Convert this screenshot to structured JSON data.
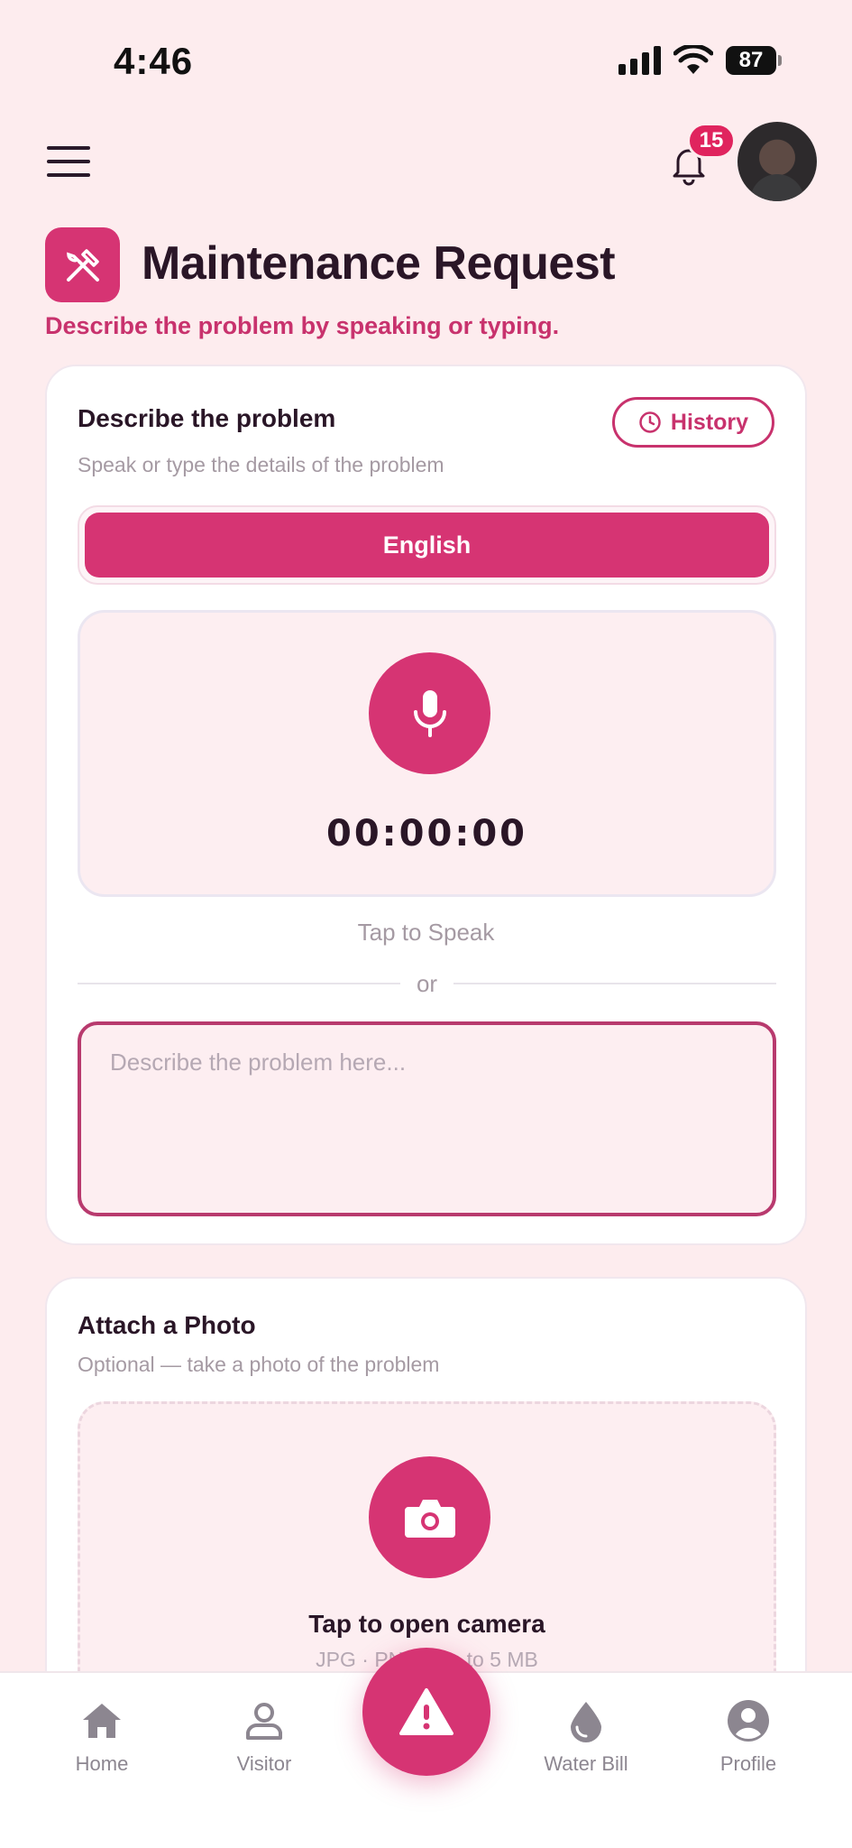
{
  "status_bar": {
    "time": "4:46",
    "battery": "87"
  },
  "header": {
    "notification_count": "15"
  },
  "page": {
    "title": "Maintenance Request",
    "subtitle": "Describe the problem by speaking or typing."
  },
  "describe_card": {
    "title": "Describe the problem",
    "hint": "Speak or type the details of the problem",
    "history_label": "History",
    "language": "English",
    "timer": "00:00:00",
    "tap_to_speak": "Tap to Speak",
    "divider_text": "or",
    "text_placeholder": "Describe the problem here..."
  },
  "photo_card": {
    "title": "Attach a Photo",
    "hint": "Optional — take a photo of the problem",
    "camera_label": "Tap to open camera",
    "camera_hint": "JPG · PNG · up to 5 MB"
  },
  "bottom_nav": {
    "items": [
      {
        "label": "Home",
        "icon": "home-icon"
      },
      {
        "label": "Visitor",
        "icon": "user-icon"
      },
      {
        "label": "Water Bill",
        "icon": "water-drop-icon"
      },
      {
        "label": "Profile",
        "icon": "profile-icon"
      }
    ],
    "fab_icon": "warning-icon"
  },
  "colors": {
    "accent": "#d63473",
    "background": "#fdecee",
    "badge": "#e0245e"
  }
}
